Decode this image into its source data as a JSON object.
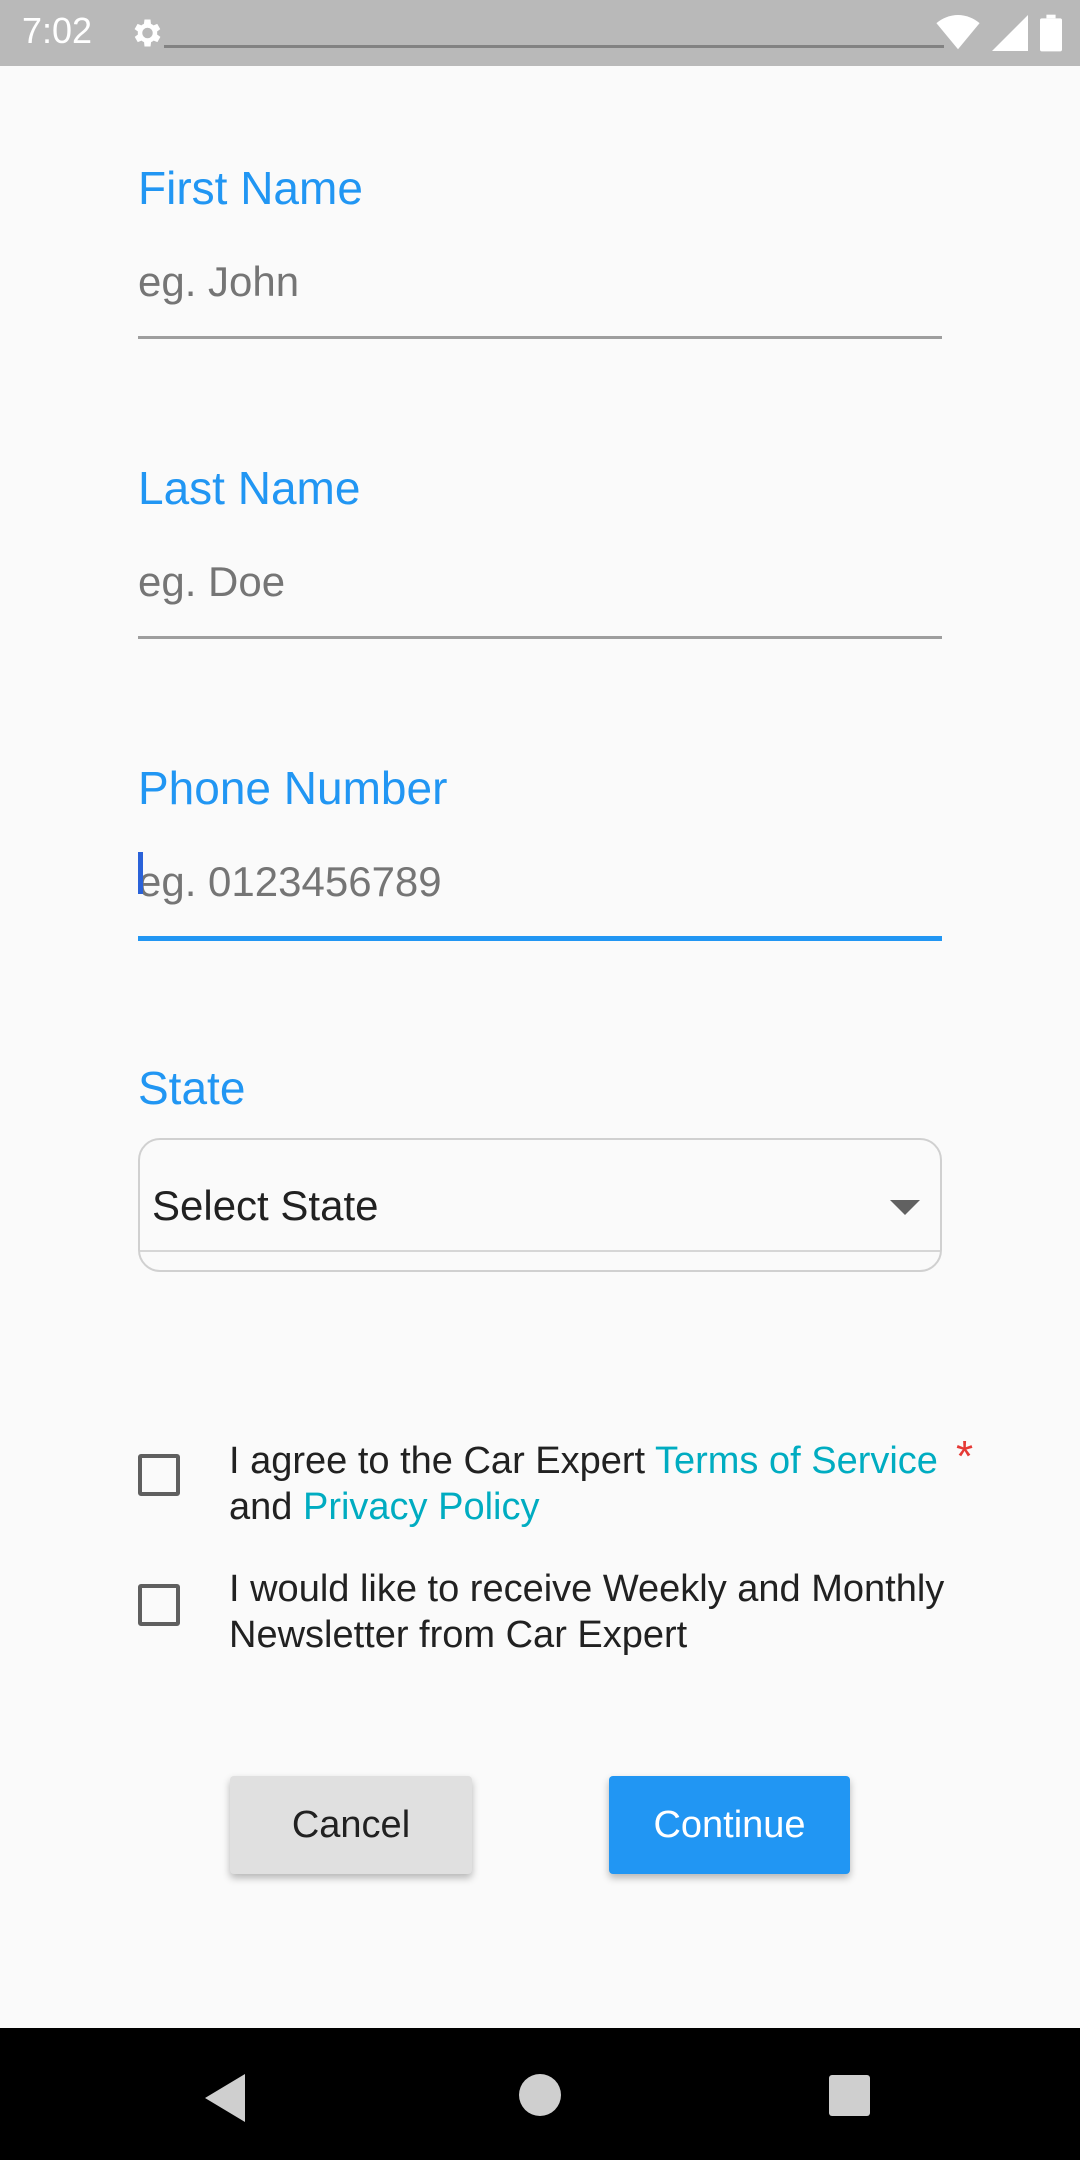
{
  "status_bar": {
    "time": "7:02",
    "icons": [
      "gear-icon",
      "wifi-icon",
      "signal-icon",
      "battery-icon"
    ]
  },
  "form": {
    "first_name": {
      "label": "First Name",
      "placeholder": "eg. John",
      "value": ""
    },
    "last_name": {
      "label": "Last Name",
      "placeholder": "eg. Doe",
      "value": ""
    },
    "phone_number": {
      "label": "Phone Number",
      "placeholder": "eg. 0123456789",
      "value": "",
      "focused": true
    },
    "state": {
      "label": "State",
      "selected": "Select State"
    }
  },
  "agreements": {
    "terms": {
      "prefix": "I agree to the Car Expert ",
      "terms_link": "Terms of Service",
      "middle": "and ",
      "privacy_link": "Privacy Policy",
      "required_mark": "*",
      "checked": false
    },
    "newsletter": {
      "text_line1": "I would like to receive Weekly and Monthly",
      "text_line2": "Newsletter from Car Expert",
      "checked": false
    }
  },
  "buttons": {
    "cancel": "Cancel",
    "continue": "Continue"
  },
  "colors": {
    "accent": "#2196f3",
    "link": "#00acc1",
    "required": "#e53935"
  },
  "nav_bar": {
    "icons": [
      "back-icon",
      "home-icon",
      "recents-icon"
    ]
  }
}
